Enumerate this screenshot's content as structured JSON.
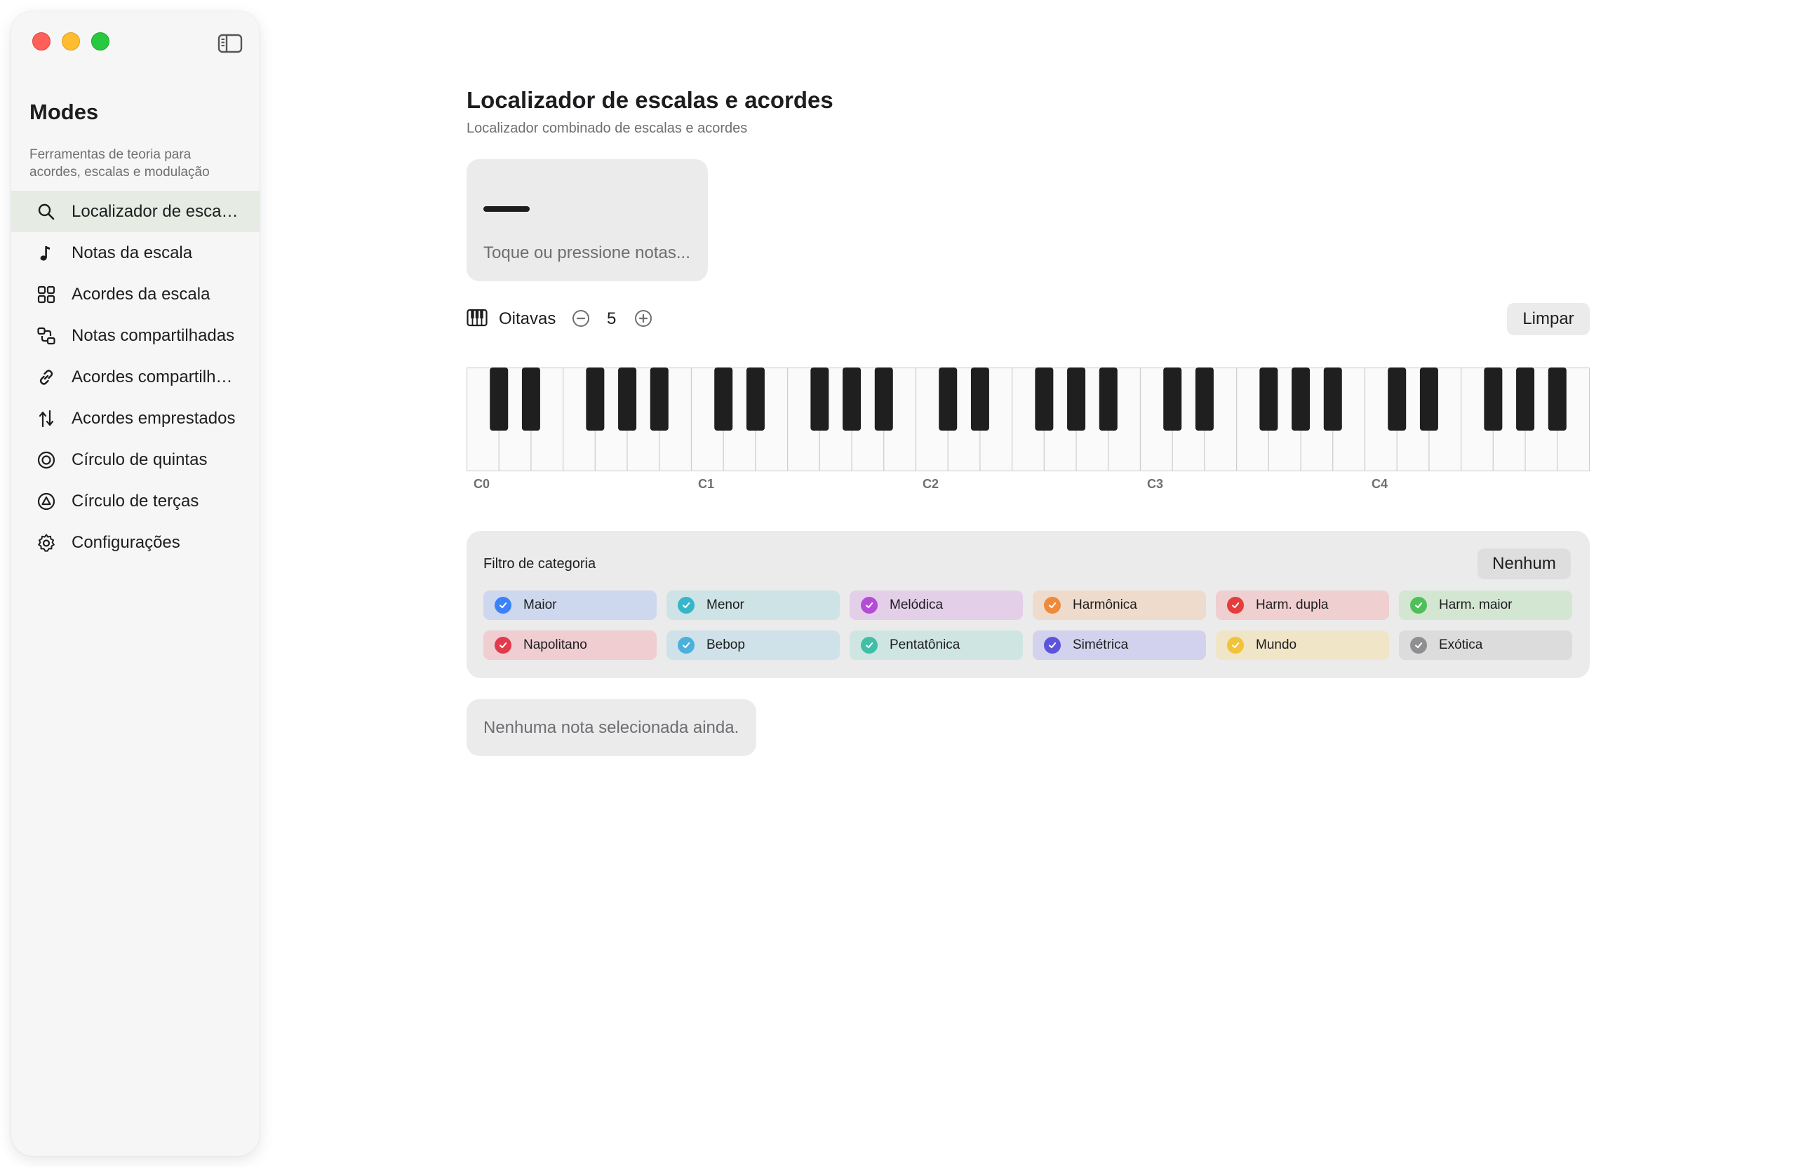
{
  "sidebar": {
    "title": "Modes",
    "description": "Ferramentas de teoria para acordes, escalas e modulação",
    "items": [
      {
        "label": "Localizador de escalas e acordes",
        "icon": "search-icon"
      },
      {
        "label": "Notas da escala",
        "icon": "music-note-icon"
      },
      {
        "label": "Acordes da escala",
        "icon": "grid-icon"
      },
      {
        "label": "Notas compartilhadas",
        "icon": "shared-shapes-icon"
      },
      {
        "label": "Acordes compartilhados",
        "icon": "link-icon"
      },
      {
        "label": "Acordes emprestados",
        "icon": "borrow-arrows-icon"
      },
      {
        "label": "Círculo de quintas",
        "icon": "target-circle-icon"
      },
      {
        "label": "Círculo de terças",
        "icon": "triangle-circle-icon"
      },
      {
        "label": "Configurações",
        "icon": "gear-icon"
      }
    ],
    "active_index": 0
  },
  "main": {
    "title": "Localizador de escalas e acordes",
    "subtitle": "Localizador combinado de escalas e acordes",
    "note_input": {
      "placeholder": "Toque ou pressione notas..."
    },
    "octaves": {
      "label": "Oitavas",
      "value": "5"
    },
    "clear_label": "Limpar",
    "piano": {
      "octave_labels": [
        "C0",
        "C1",
        "C2",
        "C3",
        "C4"
      ],
      "octave_count": 5
    },
    "filter": {
      "title": "Filtro de categoria",
      "none_label": "Nenhum",
      "categories": [
        {
          "label": "Maior",
          "color": "#3b82f6",
          "bg": "#cdd8ee",
          "checked": true
        },
        {
          "label": "Menor",
          "color": "#38b6c9",
          "bg": "#cde3e6",
          "checked": true
        },
        {
          "label": "Melódica",
          "color": "#b54bd6",
          "bg": "#e3cfe8",
          "checked": true
        },
        {
          "label": "Harmônica",
          "color": "#ee8a3c",
          "bg": "#efdbcc",
          "checked": true
        },
        {
          "label": "Harm. dupla",
          "color": "#e43d3d",
          "bg": "#efcfd0",
          "checked": true
        },
        {
          "label": "Harm. maior",
          "color": "#4fbf5a",
          "bg": "#d3e6d2",
          "checked": true
        },
        {
          "label": "Napolitano",
          "color": "#e23a4d",
          "bg": "#efcdd1",
          "checked": true
        },
        {
          "label": "Bebop",
          "color": "#4cb0dc",
          "bg": "#cfe2e9",
          "checked": true
        },
        {
          "label": "Pentatônica",
          "color": "#3fbfa7",
          "bg": "#cfe5e1",
          "checked": true
        },
        {
          "label": "Simétrica",
          "color": "#5c55db",
          "bg": "#d3d2ee",
          "checked": true
        },
        {
          "label": "Mundo",
          "color": "#f2c23a",
          "bg": "#f1e5c8",
          "checked": true
        },
        {
          "label": "Exótica",
          "color": "#8e8e93",
          "bg": "#dcdcdc",
          "checked": true
        }
      ]
    },
    "empty_message": "Nenhuma nota selecionada ainda."
  }
}
